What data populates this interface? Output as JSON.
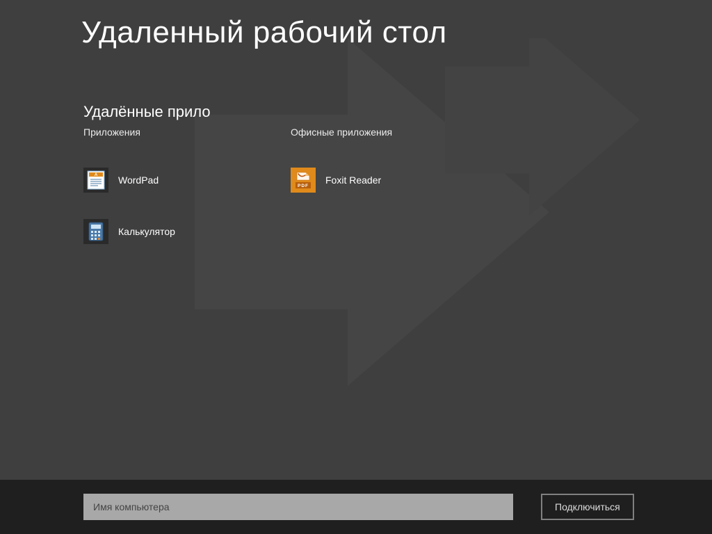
{
  "page_title": "Удаленный рабочий стол",
  "section_title": "Удалённые прило",
  "groups": {
    "apps": {
      "label": "Приложения",
      "items": [
        {
          "icon": "wordpad",
          "label": "WordPad"
        },
        {
          "icon": "calculator",
          "label": "Калькулятор"
        }
      ]
    },
    "office": {
      "label": "Офисные приложения",
      "items": [
        {
          "icon": "foxit",
          "label": "Foxit Reader"
        }
      ]
    }
  },
  "bottom": {
    "placeholder": "Имя компьютера",
    "connect_label": "Подключиться"
  },
  "colors": {
    "bg": "#3f3f3f",
    "bar": "#1f1f1f",
    "input_bg": "#a8a8a8",
    "foxit_orange": "#e08a1b"
  }
}
